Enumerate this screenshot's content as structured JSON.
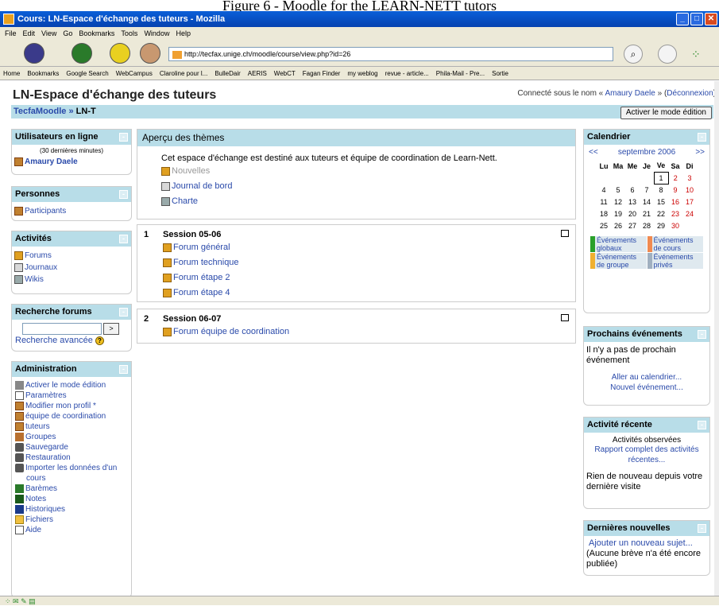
{
  "caption": "Figure 6 - Moodle for the LEARN-NETT tutors",
  "window": {
    "title": "Cours: LN-Espace d'échange des tuteurs - Mozilla"
  },
  "menu": [
    "File",
    "Edit",
    "View",
    "Go",
    "Bookmarks",
    "Tools",
    "Window",
    "Help"
  ],
  "url": "http://tecfax.unige.ch/moodle/course/view.php?id=26",
  "bookmarks": [
    "Home",
    "Bookmarks",
    "Google Search",
    "WebCampus",
    "Claroline pour l...",
    "BulleDair",
    "AERIS",
    "WebCT",
    "Fagan Finder",
    "my weblog",
    "revue - article...",
    "Phila-Mail - Pre...",
    "Sortie"
  ],
  "page": {
    "title": "LN-Espace d'échange des tuteurs",
    "login_prefix": "Connecté sous le nom «",
    "login_user": "Amaury Daele",
    "login_mid": "» (",
    "logout": "Déconnexion",
    "login_end": ")",
    "crumb_home": "TecfaMoodle",
    "crumb_sep": "»",
    "crumb_current": "LN-T",
    "edit_button": "Activer le mode édition"
  },
  "left": {
    "online": {
      "title": "Utilisateurs en ligne",
      "period": "(30 dernières minutes)",
      "user": "Amaury Daele"
    },
    "people": {
      "title": "Personnes",
      "items": [
        "Participants"
      ]
    },
    "activities": {
      "title": "Activités",
      "items": [
        "Forums",
        "Journaux",
        "Wikis"
      ]
    },
    "search": {
      "title": "Recherche forums",
      "go": ">",
      "advanced": "Recherche avancée"
    },
    "admin": {
      "title": "Administration",
      "items": [
        "Activer le mode édition",
        "Paramètres",
        "Modifier mon profil *",
        "équipe de coordination",
        "tuteurs",
        "Groupes",
        "Sauvegarde",
        "Restauration",
        "Importer les données d'un cours",
        "Barèmes",
        "Notes",
        "Historiques",
        "Fichiers",
        "Aide"
      ]
    }
  },
  "center": {
    "header": "Aperçu des thèmes",
    "intro": "Cet espace d'échange est destiné aux tuteurs et équipe de coordination de Learn-Nett.",
    "intro_links": [
      "Nouvelles",
      "Journal de bord",
      "Charte"
    ],
    "s1": {
      "num": "1",
      "title": "Session 05-06",
      "links": [
        "Forum général",
        "Forum technique",
        "Forum étape 2",
        "Forum étape 4"
      ]
    },
    "s2": {
      "num": "2",
      "title": "Session 06-07",
      "links": [
        "Forum équipe de coordination"
      ]
    }
  },
  "right": {
    "cal": {
      "title": "Calendrier",
      "prev": "<<",
      "month": "septembre 2006",
      "next": ">>",
      "days": [
        "Lu",
        "Ma",
        "Me",
        "Je",
        "Ve",
        "Sa",
        "Di"
      ],
      "rows": [
        [
          "",
          "",
          "",
          "",
          "1",
          "2",
          "3"
        ],
        [
          "4",
          "5",
          "6",
          "7",
          "8",
          "9",
          "10"
        ],
        [
          "11",
          "12",
          "13",
          "14",
          "15",
          "16",
          "17"
        ],
        [
          "18",
          "19",
          "20",
          "21",
          "22",
          "23",
          "24"
        ],
        [
          "25",
          "26",
          "27",
          "28",
          "29",
          "30",
          ""
        ]
      ],
      "legend": [
        {
          "label": "Événements globaux",
          "color": "#2aa02a"
        },
        {
          "label": "Événements de cours",
          "color": "#f08a50"
        },
        {
          "label": "Événements de groupe",
          "color": "#f0b030"
        },
        {
          "label": "Événements privés",
          "color": "#a0b0c0"
        }
      ]
    },
    "upcoming": {
      "title": "Prochains événements",
      "text": "Il n'y a pas de prochain événement",
      "goto": "Aller au calendrier...",
      "new": "Nouvel événement..."
    },
    "recent": {
      "title": "Activité récente",
      "observed": "Activités observées",
      "full": "Rapport complet des activités récentes...",
      "none": "Rien de nouveau depuis votre dernière visite"
    },
    "news": {
      "title": "Dernières nouvelles",
      "add": "Ajouter un nouveau sujet...",
      "none": "(Aucune brève n'a été encore publiée)"
    }
  }
}
